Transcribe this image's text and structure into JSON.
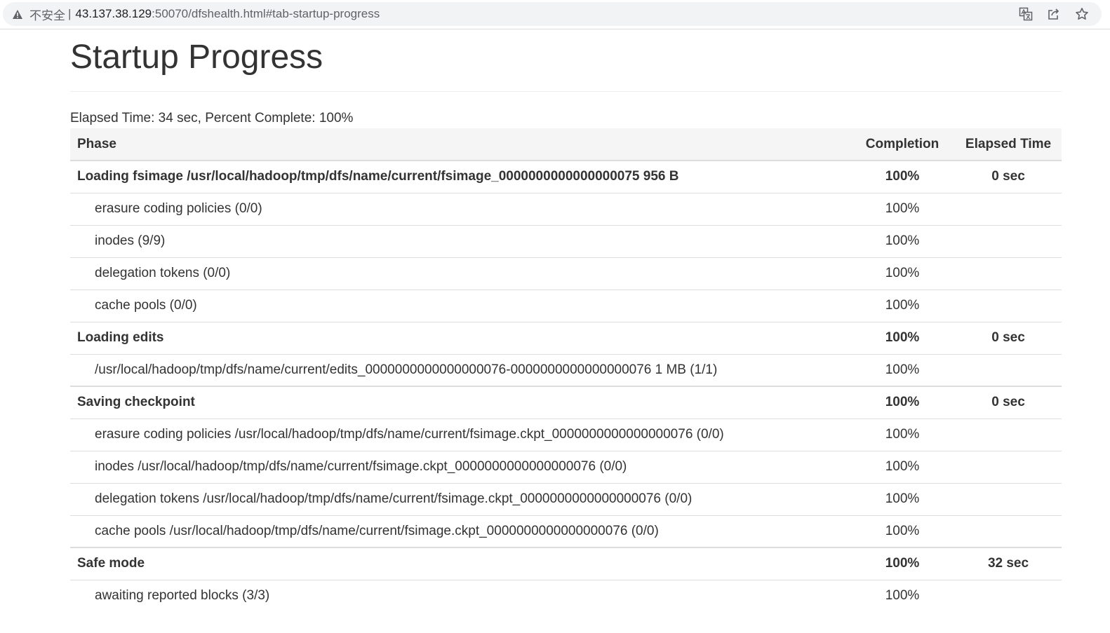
{
  "browser": {
    "insecure_label": "不安全",
    "separator": "|",
    "url_host": "43.137.38.129",
    "url_rest": ":50070/dfshealth.html#tab-startup-progress"
  },
  "page": {
    "title": "Startup Progress",
    "summary": "Elapsed Time: 34 sec, Percent Complete: 100%"
  },
  "table": {
    "headers": {
      "phase": "Phase",
      "completion": "Completion",
      "elapsed": "Elapsed Time"
    },
    "rows": [
      {
        "kind": "phase",
        "name": "Loading fsimage /usr/local/hadoop/tmp/dfs/name/current/fsimage_0000000000000000075 956 B",
        "completion": "100%",
        "elapsed": "0 sec"
      },
      {
        "kind": "step",
        "name": "erasure coding policies (0/0)",
        "completion": "100%",
        "elapsed": ""
      },
      {
        "kind": "step",
        "name": "inodes (9/9)",
        "completion": "100%",
        "elapsed": ""
      },
      {
        "kind": "step",
        "name": "delegation tokens (0/0)",
        "completion": "100%",
        "elapsed": ""
      },
      {
        "kind": "step",
        "name": "cache pools (0/0)",
        "completion": "100%",
        "elapsed": ""
      },
      {
        "kind": "phase",
        "name": "Loading edits",
        "completion": "100%",
        "elapsed": "0 sec"
      },
      {
        "kind": "step",
        "name": "/usr/local/hadoop/tmp/dfs/name/current/edits_0000000000000000076-0000000000000000076 1 MB (1/1)",
        "completion": "100%",
        "elapsed": ""
      },
      {
        "kind": "phase",
        "name": "Saving checkpoint",
        "completion": "100%",
        "elapsed": "0 sec"
      },
      {
        "kind": "step",
        "name": "erasure coding policies /usr/local/hadoop/tmp/dfs/name/current/fsimage.ckpt_0000000000000000076 (0/0)",
        "completion": "100%",
        "elapsed": ""
      },
      {
        "kind": "step",
        "name": "inodes /usr/local/hadoop/tmp/dfs/name/current/fsimage.ckpt_0000000000000000076 (0/0)",
        "completion": "100%",
        "elapsed": ""
      },
      {
        "kind": "step",
        "name": "delegation tokens /usr/local/hadoop/tmp/dfs/name/current/fsimage.ckpt_0000000000000000076 (0/0)",
        "completion": "100%",
        "elapsed": ""
      },
      {
        "kind": "step",
        "name": "cache pools /usr/local/hadoop/tmp/dfs/name/current/fsimage.ckpt_0000000000000000076 (0/0)",
        "completion": "100%",
        "elapsed": ""
      },
      {
        "kind": "phase",
        "name": "Safe mode",
        "completion": "100%",
        "elapsed": "32 sec"
      },
      {
        "kind": "step",
        "name": "awaiting reported blocks (3/3)",
        "completion": "100%",
        "elapsed": ""
      }
    ]
  }
}
